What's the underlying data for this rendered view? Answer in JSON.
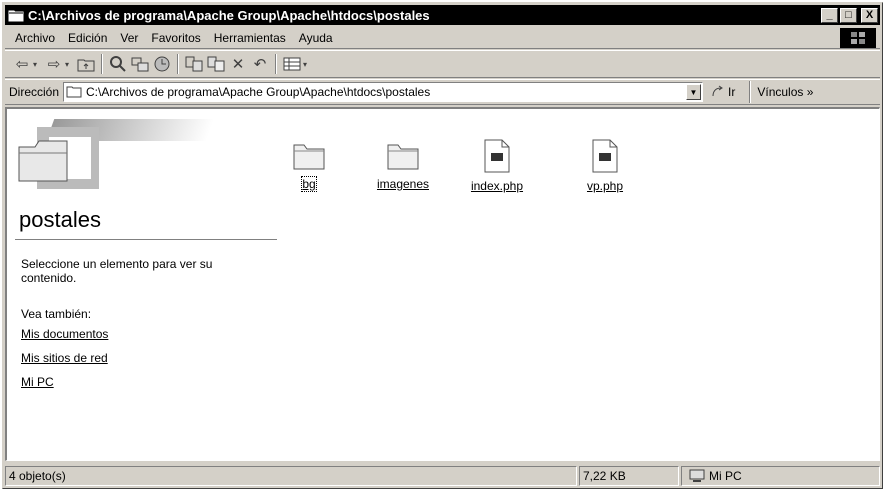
{
  "window": {
    "title": "C:\\Archivos de programa\\Apache Group\\Apache\\htdocs\\postales",
    "controls": {
      "minimize": "_",
      "maximize": "□",
      "close": "X"
    }
  },
  "menu": {
    "items": [
      {
        "label": "Archivo"
      },
      {
        "label": "Edición"
      },
      {
        "label": "Ver"
      },
      {
        "label": "Favoritos"
      },
      {
        "label": "Herramientas"
      },
      {
        "label": "Ayuda"
      }
    ]
  },
  "toolbar": {
    "icons": [
      "back-arrow",
      "forward-arrow",
      "up-folder",
      "search",
      "folders",
      "history",
      "move-to",
      "copy-to",
      "delete",
      "undo",
      "views"
    ]
  },
  "address": {
    "label": "Dirección",
    "value": "C:\\Archivos de programa\\Apache Group\\Apache\\htdocs\\postales",
    "go_label": "Ir",
    "links_label": "Vínculos »"
  },
  "sidebar": {
    "folder_title": "postales",
    "description": "Seleccione un elemento para ver su contenido.",
    "see_also": "Vea también:",
    "links": [
      "Mis documentos",
      "Mis sitios de red",
      "Mi PC"
    ]
  },
  "files": [
    {
      "name": "bg",
      "type": "folder",
      "selected": true
    },
    {
      "name": "imagenes",
      "type": "folder",
      "selected": false
    },
    {
      "name": "index.php",
      "type": "file",
      "selected": false
    },
    {
      "name": "vp.php",
      "type": "file",
      "selected": false
    }
  ],
  "status": {
    "count": "4 objeto(s)",
    "size": "7,22 KB",
    "zone": "Mi PC"
  },
  "colors": {
    "titlebar": "#000000",
    "face": "#d4d0c8"
  }
}
